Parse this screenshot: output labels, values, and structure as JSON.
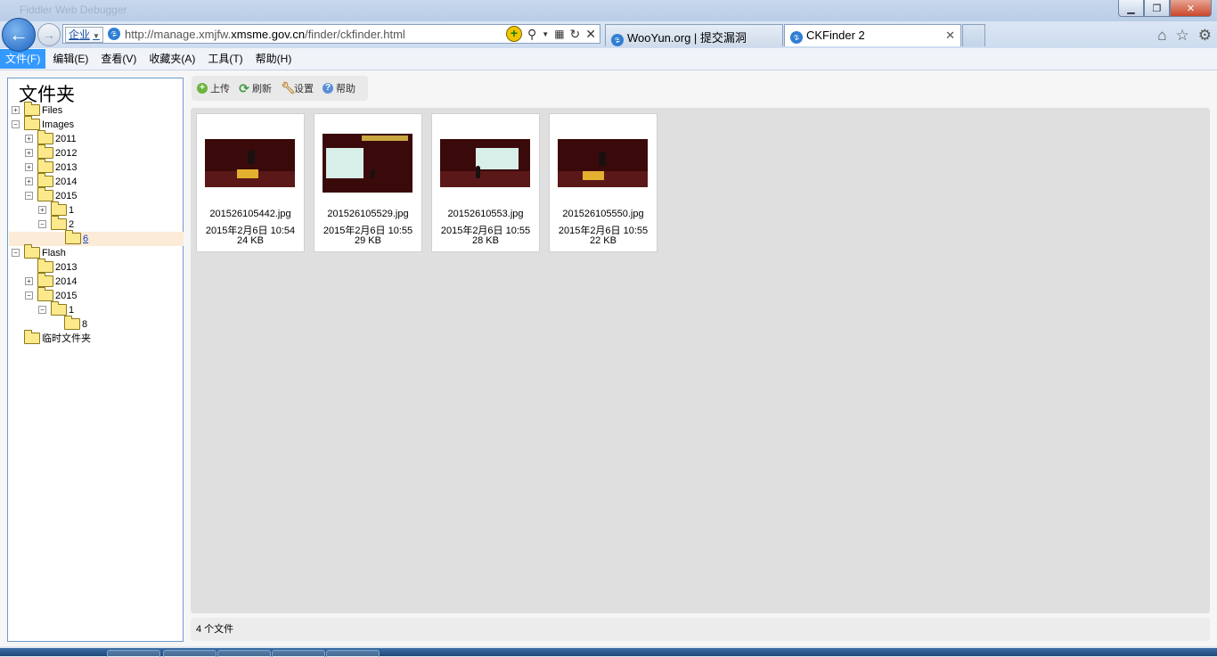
{
  "window": {
    "ghost_title": "Fiddler Web Debugger",
    "controls": [
      "minimize-icon",
      "restore-icon",
      "close-icon"
    ]
  },
  "address_bar": {
    "zone": "企业",
    "url_prefix": "http://manage.xmjfw.",
    "url_domain": "xmsme.gov.cn",
    "url_suffix": "/finder/ckfinder.html"
  },
  "tabs": [
    {
      "label": "WooYun.org | 提交漏洞",
      "active": false
    },
    {
      "label": "CKFinder 2",
      "active": true
    }
  ],
  "menubar": {
    "items": [
      {
        "label": "文件(F)",
        "active": true
      },
      {
        "label": "编辑(E)",
        "active": false
      },
      {
        "label": "查看(V)",
        "active": false
      },
      {
        "label": "收藏夹(A)",
        "active": false
      },
      {
        "label": "工具(T)",
        "active": false
      },
      {
        "label": "帮助(H)",
        "active": false
      }
    ]
  },
  "folder_panel": {
    "title": "文件夹",
    "tree": [
      {
        "label": "Files",
        "expander": "+",
        "depth": 0
      },
      {
        "label": "Images",
        "expander": "−",
        "depth": 0
      },
      {
        "label": "2011",
        "expander": "+",
        "depth": 1
      },
      {
        "label": "2012",
        "expander": "+",
        "depth": 1
      },
      {
        "label": "2013",
        "expander": "+",
        "depth": 1
      },
      {
        "label": "2014",
        "expander": "+",
        "depth": 1
      },
      {
        "label": "2015",
        "expander": "−",
        "depth": 1
      },
      {
        "label": "1",
        "expander": "+",
        "depth": 2
      },
      {
        "label": "2",
        "expander": "−",
        "depth": 2
      },
      {
        "label": "6",
        "expander": "",
        "depth": 3,
        "selected": true
      },
      {
        "label": "Flash",
        "expander": "−",
        "depth": 0
      },
      {
        "label": "2013",
        "expander": "",
        "depth": 1
      },
      {
        "label": "2014",
        "expander": "+",
        "depth": 1
      },
      {
        "label": "2015",
        "expander": "−",
        "depth": 1
      },
      {
        "label": "1",
        "expander": "−",
        "depth": 2
      },
      {
        "label": "8",
        "expander": "",
        "depth": 3
      },
      {
        "label": "临时文件夹",
        "expander": "",
        "depth": 0
      }
    ]
  },
  "toolbar": {
    "upload": "上传",
    "refresh": "刷新",
    "settings": "设置",
    "help": "帮助"
  },
  "files": [
    {
      "name": "201526105442.jpg",
      "date": "2015年2月6日 10:54",
      "size": "24 KB"
    },
    {
      "name": "201526105529.jpg",
      "date": "2015年2月6日 10:55",
      "size": "29 KB"
    },
    {
      "name": "20152610553.jpg",
      "date": "2015年2月6日 10:55",
      "size": "28 KB"
    },
    {
      "name": "201526105550.jpg",
      "date": "2015年2月6日 10:55",
      "size": "22 KB"
    }
  ],
  "status": {
    "file_count": "4 个文件"
  }
}
